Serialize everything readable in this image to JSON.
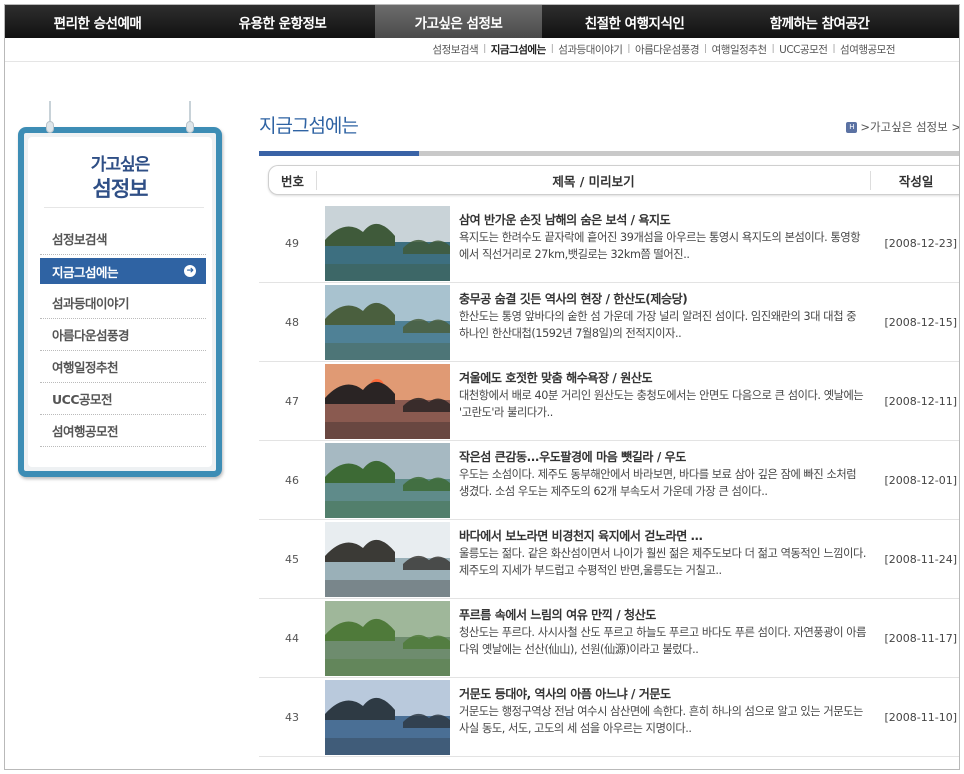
{
  "nav": {
    "items": [
      {
        "label": "편리한 승선예매"
      },
      {
        "label": "유용한 운항정보"
      },
      {
        "label": "가고싶은 섬정보"
      },
      {
        "label": "친절한 여행지식인"
      },
      {
        "label": "함께하는 참여공간"
      }
    ],
    "active_index": 2
  },
  "subnav": {
    "items": [
      {
        "label": "섬정보검색"
      },
      {
        "label": "지금그섬에는"
      },
      {
        "label": "섬과등대이야기"
      },
      {
        "label": "아름다운섬풍경"
      },
      {
        "label": "여행일정추천"
      },
      {
        "label": "UCC공모전"
      },
      {
        "label": "섬여행공모전"
      }
    ]
  },
  "sidebar": {
    "title_line1": "가고싶은",
    "title_line2": "섬정보",
    "items": [
      {
        "label": "섬정보검색"
      },
      {
        "label": "지금그섬에는"
      },
      {
        "label": "섬과등대이야기"
      },
      {
        "label": "아름다운섬풍경"
      },
      {
        "label": "여행일정추천"
      },
      {
        "label": "UCC공모전"
      },
      {
        "label": "섬여행공모전"
      }
    ],
    "active_index": 1,
    "accent_color": "#2f63a3",
    "frame_color": "#3d8db5"
  },
  "main": {
    "page_title": "지금그섬에는",
    "breadcrumb": ">가고싶은 섬정보 >",
    "columns": {
      "num": "번호",
      "title": "제목 / 미리보기",
      "date": "작성일"
    },
    "rows": [
      {
        "num": "49",
        "title": "삼여 반가운 손짓 남해의 숨은 보석 / 욕지도",
        "desc": "욕지도는 한려수도 끝자락에 흩어진 39개섬을 아우르는 통영시 욕지도의 본섬이다. 통영항에서 직선거리로 27km,뱃길로는 32km쯤 떨어진..",
        "date": "[2008-12-23]"
      },
      {
        "num": "48",
        "title": "충무공 숨결 깃든 역사의 현장 / 한산도(제승당)",
        "desc": "한산도는 통영 앞바다의 숱한 섬 가운데 가장 널리 알려진 섬이다. 임진왜란의 3대 대첩 중 하나인 한산대첩(1592년 7월8일)의 전적지이자..",
        "date": "[2008-12-15]"
      },
      {
        "num": "47",
        "title": "겨울에도 호젓한 맞춤 해수욕장 / 원산도",
        "desc": "대천항에서 배로 40분 거리인 원산도는 충청도에서는 안면도 다음으로 큰 섬이다. 옛날에는 '고란도'라 불리다가..",
        "date": "[2008-12-11]"
      },
      {
        "num": "46",
        "title": "작은섬 큰감동...우도팔경에 마음 뺏길라 / 우도",
        "desc": "우도는 소섬이다. 제주도 동부해안에서 바라보면, 바다를 보료 삼아 깊은 잠에 빠진 소처럼 생겼다. 소섬 우도는 제주도의 62개 부속도서 가운데 가장 큰 섬이다..",
        "date": "[2008-12-01]"
      },
      {
        "num": "45",
        "title": "바다에서 보노라면 비경천지 육지에서 걷노라면 …",
        "desc": "울릉도는 젊다. 같은 화산섬이면서 나이가 훨씬 젊은 제주도보다 더 젊고 역동적인 느낌이다. 제주도의 지세가 부드럽고 수평적인 반면,울릉도는 거칠고..",
        "date": "[2008-11-24]"
      },
      {
        "num": "44",
        "title": "푸르름 속에서 느림의 여유 만끽 / 청산도",
        "desc": "청산도는 푸르다. 사시사철 산도 푸르고 하늘도 푸르고 바다도 푸른 섬이다. 자연풍광이 아름다워 옛날에는 선산(仙山), 선원(仙源)이라고 불렀다..",
        "date": "[2008-11-17]"
      },
      {
        "num": "43",
        "title": "거문도 등대야, 역사의 아픔 아느냐 / 거문도",
        "desc": "거문도는 행정구역상 전남 여수시 삼산면에 속한다. 흔히 하나의 섬으로 알고 있는 거문도는 사실 동도, 서도, 고도의 세 섬을 아우르는 지명이다..",
        "date": "[2008-11-10]"
      }
    ]
  },
  "thumbnails": [
    {
      "sky": "#c9d3d8",
      "sea": "#3d6f80",
      "land": "#3f5a3a"
    },
    {
      "sky": "#a8c2cf",
      "sea": "#4f8196",
      "land": "#4a5f3e"
    },
    {
      "sky": "#e09a74",
      "sea": "#8a5a50",
      "land": "#2a2424",
      "sun": "#ff6a3a"
    },
    {
      "sky": "#a6b9c2",
      "sea": "#5f8b8a",
      "land": "#3d6a35"
    },
    {
      "sky": "#e8edf0",
      "sea": "#9ab0b8",
      "land": "#3b3a36"
    },
    {
      "sky": "#9fb79a",
      "sea": "#6e8c6e",
      "land": "#4f7a3a"
    },
    {
      "sky": "#b9c9dc",
      "sea": "#4a6f95",
      "land": "#2e3a44"
    }
  ]
}
